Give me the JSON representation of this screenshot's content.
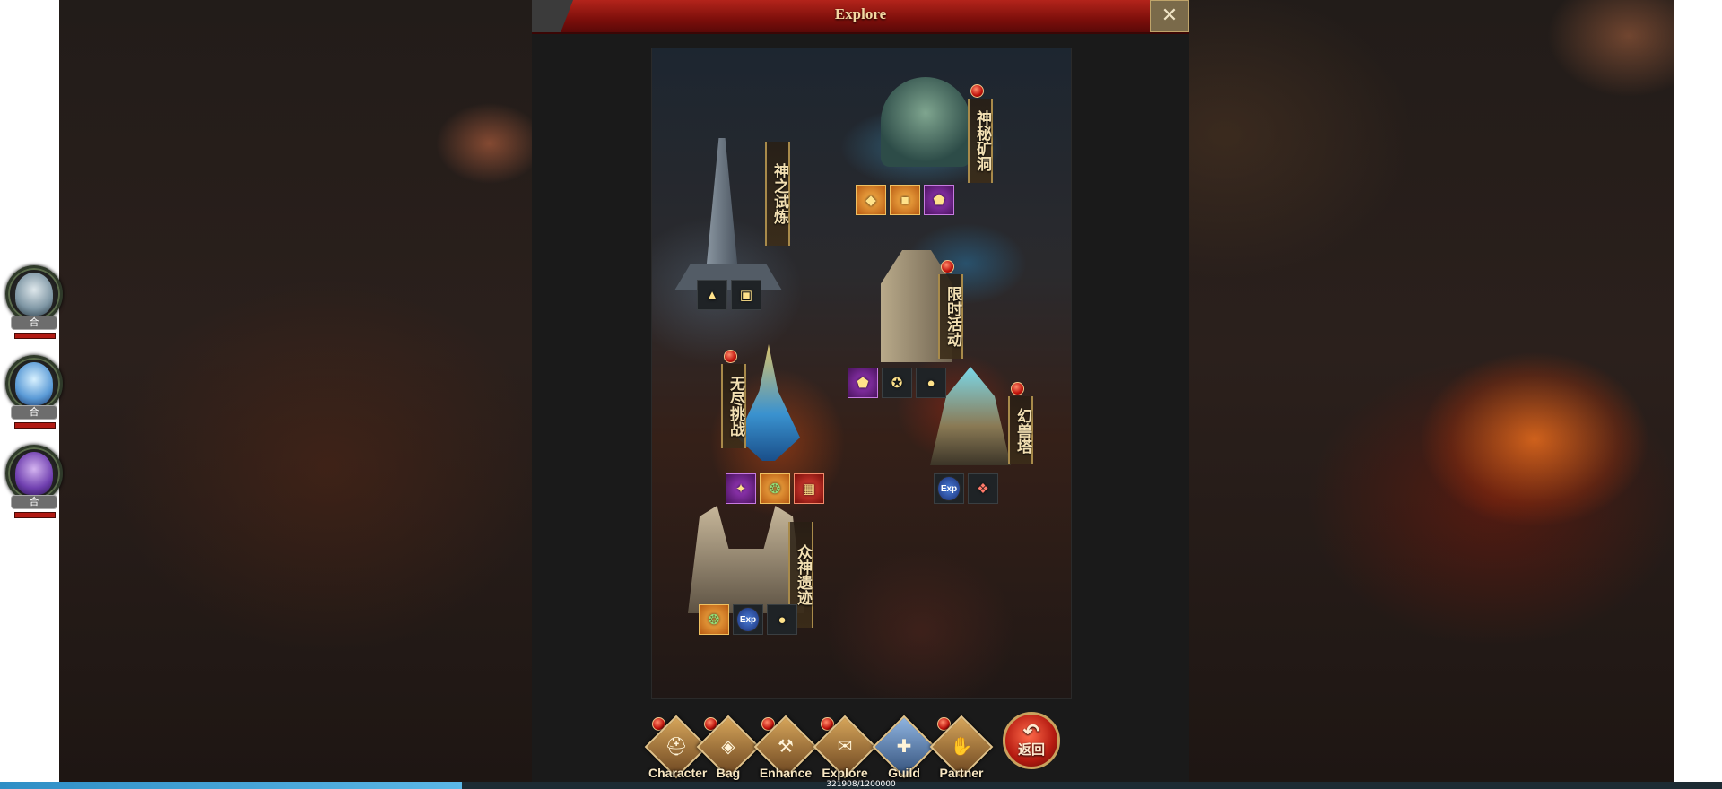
{
  "window": {
    "title": "Explore",
    "close_symbol": "✕"
  },
  "sidebar": {
    "partners": [
      {
        "tag": "合",
        "color": "#8fd0e0"
      },
      {
        "tag": "合",
        "color": "#6fb0ea"
      },
      {
        "tag": "合",
        "color": "#9a6ad8"
      }
    ]
  },
  "map": {
    "locations": [
      {
        "name": "神之试炼",
        "icons": [
          "triangle-emblem-icon",
          "treasure-chest-icon"
        ]
      },
      {
        "name": "神秘矿洞",
        "icons": [
          "orange-ore-icon",
          "gift-box-icon",
          "gold-crystal-icon"
        ]
      },
      {
        "name": "限时活动",
        "icons": [
          "gold-crystal-icon",
          "event-badge-icon",
          "gold-coins-icon"
        ]
      },
      {
        "name": "无尽挑战",
        "icons": [
          "skill-book-icon",
          "green-gem-icon",
          "red-chest-icon"
        ]
      },
      {
        "name": "幻兽塔",
        "icons": [
          "exp-orb-icon",
          "beast-egg-icon"
        ]
      },
      {
        "name": "众神遗迹",
        "icons": [
          "green-gem-icon",
          "exp-orb-icon",
          "gold-coins-icon"
        ]
      }
    ],
    "exp_label": "Exp"
  },
  "nav": {
    "items": [
      {
        "label": "Character",
        "icon": "helmet-icon"
      },
      {
        "label": "Bag",
        "icon": "bag-icon"
      },
      {
        "label": "Enhance",
        "icon": "anvil-icon"
      },
      {
        "label": "Explore",
        "icon": "scroll-icon"
      },
      {
        "label": "Guild",
        "icon": "guild-crest-icon"
      },
      {
        "label": "Partner",
        "icon": "partner-icon"
      }
    ],
    "return_label": "返回"
  },
  "exp": {
    "text": "321908/1200000",
    "current": 321908,
    "max": 1200000
  },
  "colors": {
    "title_red": "#b3241b",
    "accent_gold": "#c9a25e",
    "exp_blue": "#2e8ec5"
  }
}
